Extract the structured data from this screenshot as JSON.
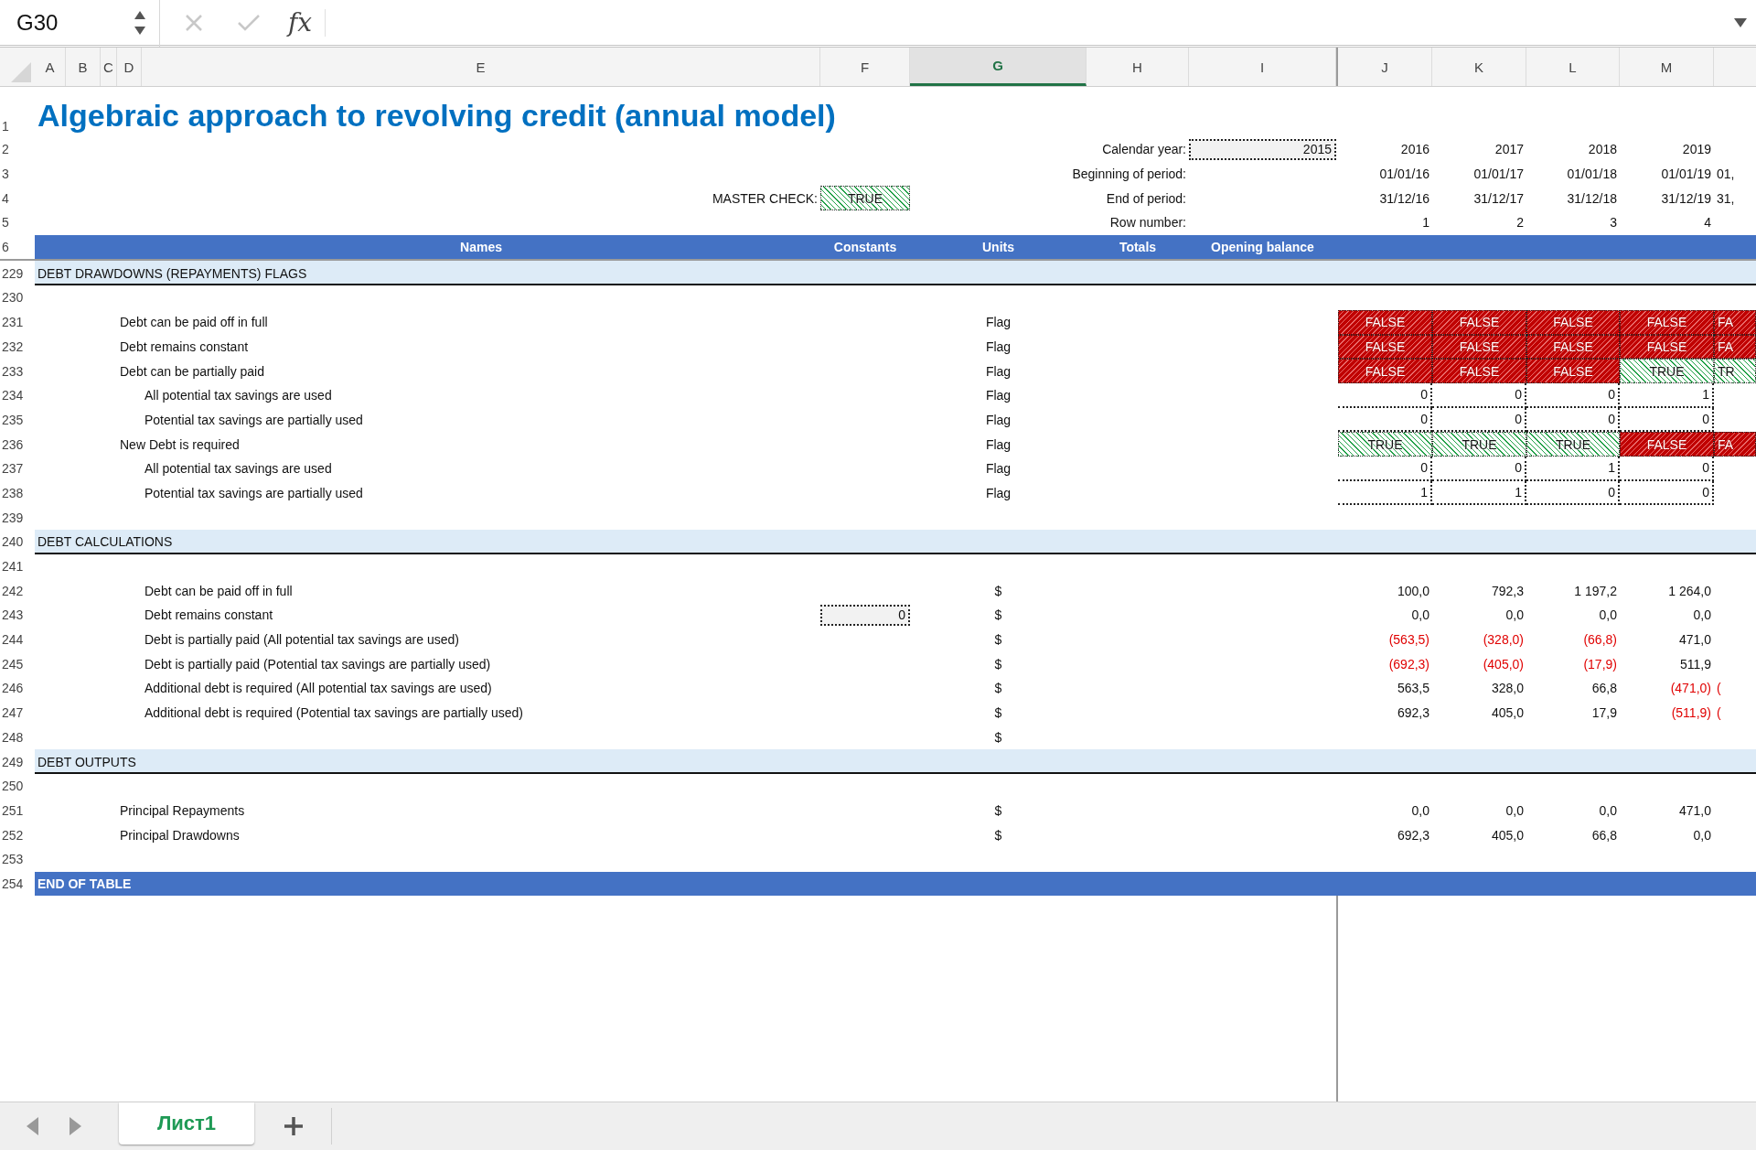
{
  "formula_bar": {
    "name_box": "G30",
    "function_label": "fx"
  },
  "column_headers": [
    {
      "label": "A",
      "selected": false
    },
    {
      "label": "B",
      "selected": false
    },
    {
      "label": "C",
      "selected": false
    },
    {
      "label": "D",
      "selected": false
    },
    {
      "label": "E",
      "selected": false
    },
    {
      "label": "F",
      "selected": false
    },
    {
      "label": "G",
      "selected": true
    },
    {
      "label": "H",
      "selected": false
    },
    {
      "label": "I",
      "selected": false
    },
    {
      "label": "J",
      "selected": false
    },
    {
      "label": "K",
      "selected": false
    },
    {
      "label": "L",
      "selected": false
    },
    {
      "label": "M",
      "selected": false
    }
  ],
  "rows": [
    {
      "number": "1",
      "kind": "title",
      "cells": {
        "A": {
          "kind": "title",
          "text": "Algebraic approach to revolving credit (annual model)"
        }
      }
    },
    {
      "number": "2",
      "kind": "plain",
      "cells": {
        "H": {
          "kind": "caption",
          "text": "Calendar year:"
        },
        "I": {
          "kind": "input",
          "text": "2015"
        },
        "J": {
          "kind": "number",
          "text": "2016"
        },
        "K": {
          "kind": "number",
          "text": "2017"
        },
        "L": {
          "kind": "number",
          "text": "2018"
        },
        "M": {
          "kind": "number",
          "text": "2019"
        }
      }
    },
    {
      "number": "3",
      "kind": "plain",
      "cells": {
        "H": {
          "kind": "caption",
          "text": "Beginning of period:"
        },
        "J": {
          "kind": "number",
          "text": "01/01/16"
        },
        "K": {
          "kind": "number",
          "text": "01/01/17"
        },
        "L": {
          "kind": "number",
          "text": "01/01/18"
        },
        "M": {
          "kind": "number",
          "text": "01/01/19"
        },
        "N": {
          "kind": "number",
          "text": "01,"
        }
      }
    },
    {
      "number": "4",
      "kind": "plain",
      "cells": {
        "E": {
          "kind": "caption",
          "text": "MASTER CHECK:"
        },
        "F": {
          "kind": "flag",
          "text": "TRUE",
          "passed": true
        },
        "H": {
          "kind": "caption",
          "text": "End of period:"
        },
        "J": {
          "kind": "number",
          "text": "31/12/16"
        },
        "K": {
          "kind": "number",
          "text": "31/12/17"
        },
        "L": {
          "kind": "number",
          "text": "31/12/18"
        },
        "M": {
          "kind": "number",
          "text": "31/12/19"
        },
        "N": {
          "kind": "number",
          "text": "31,"
        }
      }
    },
    {
      "number": "5",
      "kind": "plain",
      "cells": {
        "H": {
          "kind": "caption",
          "text": "Row number:"
        },
        "J": {
          "kind": "number",
          "text": "1"
        },
        "K": {
          "kind": "number",
          "text": "2"
        },
        "L": {
          "kind": "number",
          "text": "3"
        },
        "M": {
          "kind": "number",
          "text": "4"
        }
      }
    },
    {
      "number": "6",
      "kind": "header",
      "cells": {
        "E": {
          "kind": "header",
          "text": "Names"
        },
        "F": {
          "kind": "header",
          "text": "Constants"
        },
        "G": {
          "kind": "header",
          "text": "Units"
        },
        "H": {
          "kind": "header",
          "text": "Totals"
        },
        "I": {
          "kind": "header",
          "text": "Opening balance"
        }
      }
    },
    {
      "number": "229",
      "kind": "section",
      "cells": {
        "A": {
          "kind": "label",
          "text": "DEBT DRAWDOWNS (REPAYMENTS) FLAGS"
        }
      }
    },
    {
      "number": "230",
      "kind": "plain",
      "cells": {}
    },
    {
      "number": "231",
      "kind": "plain",
      "cells": {
        "D": {
          "kind": "label",
          "text": "Debt can be paid off in full"
        },
        "G": {
          "kind": "unit",
          "text": "Flag"
        },
        "J": {
          "kind": "flag",
          "text": "FALSE",
          "passed": false
        },
        "K": {
          "kind": "flag",
          "text": "FALSE",
          "passed": false
        },
        "L": {
          "kind": "flag",
          "text": "FALSE",
          "passed": false
        },
        "M": {
          "kind": "flag",
          "text": "FALSE",
          "passed": false
        },
        "N": {
          "kind": "flag",
          "text": "FA",
          "passed": false
        }
      }
    },
    {
      "number": "232",
      "kind": "plain",
      "cells": {
        "D": {
          "kind": "label",
          "text": "Debt remains constant"
        },
        "G": {
          "kind": "unit",
          "text": "Flag"
        },
        "J": {
          "kind": "flag",
          "text": "FALSE",
          "passed": false
        },
        "K": {
          "kind": "flag",
          "text": "FALSE",
          "passed": false
        },
        "L": {
          "kind": "flag",
          "text": "FALSE",
          "passed": false
        },
        "M": {
          "kind": "flag",
          "text": "FALSE",
          "passed": false
        },
        "N": {
          "kind": "flag",
          "text": "FA",
          "passed": false
        }
      }
    },
    {
      "number": "233",
      "kind": "plain",
      "cells": {
        "D": {
          "kind": "label",
          "text": "Debt can be partially paid"
        },
        "G": {
          "kind": "unit",
          "text": "Flag"
        },
        "J": {
          "kind": "flag",
          "text": "FALSE",
          "passed": false
        },
        "K": {
          "kind": "flag",
          "text": "FALSE",
          "passed": false
        },
        "L": {
          "kind": "flag",
          "text": "FALSE",
          "passed": false
        },
        "M": {
          "kind": "flag",
          "text": "TRUE",
          "passed": true
        },
        "N": {
          "kind": "flag",
          "text": "TR",
          "passed": true
        }
      }
    },
    {
      "number": "234",
      "kind": "plain",
      "cells": {
        "E": {
          "kind": "label",
          "text": "All potential tax savings are used"
        },
        "G": {
          "kind": "unit",
          "text": "Flag"
        },
        "J": {
          "kind": "count",
          "text": "0"
        },
        "K": {
          "kind": "count",
          "text": "0"
        },
        "L": {
          "kind": "count",
          "text": "0"
        },
        "M": {
          "kind": "count",
          "text": "1"
        }
      }
    },
    {
      "number": "235",
      "kind": "plain",
      "cells": {
        "E": {
          "kind": "label",
          "text": "Potential tax savings are partially used"
        },
        "G": {
          "kind": "unit",
          "text": "Flag"
        },
        "J": {
          "kind": "count",
          "text": "0"
        },
        "K": {
          "kind": "count",
          "text": "0"
        },
        "L": {
          "kind": "count",
          "text": "0"
        },
        "M": {
          "kind": "count",
          "text": "0"
        }
      }
    },
    {
      "number": "236",
      "kind": "plain",
      "cells": {
        "D": {
          "kind": "label",
          "text": "New Debt is required"
        },
        "G": {
          "kind": "unit",
          "text": "Flag"
        },
        "J": {
          "kind": "flag",
          "text": "TRUE",
          "passed": true
        },
        "K": {
          "kind": "flag",
          "text": "TRUE",
          "passed": true
        },
        "L": {
          "kind": "flag",
          "text": "TRUE",
          "passed": true
        },
        "M": {
          "kind": "flag",
          "text": "FALSE",
          "passed": false
        },
        "N": {
          "kind": "flag",
          "text": "FA",
          "passed": false
        }
      }
    },
    {
      "number": "237",
      "kind": "plain",
      "cells": {
        "E": {
          "kind": "label",
          "text": "All potential tax savings are used"
        },
        "G": {
          "kind": "unit",
          "text": "Flag"
        },
        "J": {
          "kind": "count",
          "text": "0"
        },
        "K": {
          "kind": "count",
          "text": "0"
        },
        "L": {
          "kind": "count",
          "text": "1"
        },
        "M": {
          "kind": "count",
          "text": "0"
        }
      }
    },
    {
      "number": "238",
      "kind": "plain",
      "cells": {
        "E": {
          "kind": "label",
          "text": "Potential tax savings are partially used"
        },
        "G": {
          "kind": "unit",
          "text": "Flag"
        },
        "J": {
          "kind": "count",
          "text": "1"
        },
        "K": {
          "kind": "count",
          "text": "1"
        },
        "L": {
          "kind": "count",
          "text": "0"
        },
        "M": {
          "kind": "count",
          "text": "0"
        }
      }
    },
    {
      "number": "239",
      "kind": "plain",
      "cells": {}
    },
    {
      "number": "240",
      "kind": "section",
      "cells": {
        "A": {
          "kind": "label",
          "text": "DEBT CALCULATIONS"
        }
      }
    },
    {
      "number": "241",
      "kind": "plain",
      "cells": {}
    },
    {
      "number": "242",
      "kind": "plain",
      "cells": {
        "E": {
          "kind": "label",
          "text": "Debt can be paid off in full"
        },
        "G": {
          "kind": "unit",
          "text": "$"
        },
        "J": {
          "kind": "number",
          "text": "100,0",
          "negative": false
        },
        "K": {
          "kind": "number",
          "text": "792,3",
          "negative": false
        },
        "L": {
          "kind": "number",
          "text": "1 197,2",
          "negative": false
        },
        "M": {
          "kind": "number",
          "text": "1 264,0",
          "negative": false
        }
      }
    },
    {
      "number": "243",
      "kind": "plain",
      "cells": {
        "E": {
          "kind": "label",
          "text": "Debt remains constant"
        },
        "F": {
          "kind": "input",
          "text": "0"
        },
        "G": {
          "kind": "unit",
          "text": "$"
        },
        "J": {
          "kind": "number",
          "text": "0,0",
          "negative": false
        },
        "K": {
          "kind": "number",
          "text": "0,0",
          "negative": false
        },
        "L": {
          "kind": "number",
          "text": "0,0",
          "negative": false
        },
        "M": {
          "kind": "number",
          "text": "0,0",
          "negative": false
        }
      }
    },
    {
      "number": "244",
      "kind": "plain",
      "cells": {
        "E": {
          "kind": "label",
          "text": "Debt is partially paid (All potential tax savings are used)"
        },
        "G": {
          "kind": "unit",
          "text": "$"
        },
        "J": {
          "kind": "number",
          "text": "(563,5)",
          "negative": true
        },
        "K": {
          "kind": "number",
          "text": "(328,0)",
          "negative": true
        },
        "L": {
          "kind": "number",
          "text": "(66,8)",
          "negative": true
        },
        "M": {
          "kind": "number",
          "text": "471,0",
          "negative": false
        }
      }
    },
    {
      "number": "245",
      "kind": "plain",
      "cells": {
        "E": {
          "kind": "label",
          "text": "Debt is partially paid (Potential tax savings are partially used)"
        },
        "G": {
          "kind": "unit",
          "text": "$"
        },
        "J": {
          "kind": "number",
          "text": "(692,3)",
          "negative": true
        },
        "K": {
          "kind": "number",
          "text": "(405,0)",
          "negative": true
        },
        "L": {
          "kind": "number",
          "text": "(17,9)",
          "negative": true
        },
        "M": {
          "kind": "number",
          "text": "511,9",
          "negative": false
        }
      }
    },
    {
      "number": "246",
      "kind": "plain",
      "cells": {
        "E": {
          "kind": "label",
          "text": "Additional debt is required (All potential tax savings are used)"
        },
        "G": {
          "kind": "unit",
          "text": "$"
        },
        "J": {
          "kind": "number",
          "text": "563,5",
          "negative": false
        },
        "K": {
          "kind": "number",
          "text": "328,0",
          "negative": false
        },
        "L": {
          "kind": "number",
          "text": "66,8",
          "negative": false
        },
        "M": {
          "kind": "number",
          "text": "(471,0)",
          "negative": true
        },
        "N": {
          "kind": "number",
          "text": "(",
          "negative": true
        }
      }
    },
    {
      "number": "247",
      "kind": "plain",
      "cells": {
        "E": {
          "kind": "label",
          "text": "Additional debt is required (Potential tax savings are partially used)"
        },
        "G": {
          "kind": "unit",
          "text": "$"
        },
        "J": {
          "kind": "number",
          "text": "692,3",
          "negative": false
        },
        "K": {
          "kind": "number",
          "text": "405,0",
          "negative": false
        },
        "L": {
          "kind": "number",
          "text": "17,9",
          "negative": false
        },
        "M": {
          "kind": "number",
          "text": "(511,9)",
          "negative": true
        },
        "N": {
          "kind": "number",
          "text": "(",
          "negative": true
        }
      }
    },
    {
      "number": "248",
      "kind": "plain",
      "cells": {
        "G": {
          "kind": "unit",
          "text": "$"
        }
      }
    },
    {
      "number": "249",
      "kind": "section",
      "cells": {
        "A": {
          "kind": "label",
          "text": "DEBT OUTPUTS"
        }
      }
    },
    {
      "number": "250",
      "kind": "plain",
      "cells": {}
    },
    {
      "number": "251",
      "kind": "plain",
      "cells": {
        "D": {
          "kind": "label",
          "text": "Principal Repayments"
        },
        "G": {
          "kind": "unit",
          "text": "$"
        },
        "J": {
          "kind": "number",
          "text": "0,0",
          "negative": false
        },
        "K": {
          "kind": "number",
          "text": "0,0",
          "negative": false
        },
        "L": {
          "kind": "number",
          "text": "0,0",
          "negative": false
        },
        "M": {
          "kind": "number",
          "text": "471,0",
          "negative": false
        }
      }
    },
    {
      "number": "252",
      "kind": "plain",
      "cells": {
        "D": {
          "kind": "label",
          "text": "Principal Drawdowns"
        },
        "G": {
          "kind": "unit",
          "text": "$"
        },
        "J": {
          "kind": "number",
          "text": "692,3",
          "negative": false
        },
        "K": {
          "kind": "number",
          "text": "405,0",
          "negative": false
        },
        "L": {
          "kind": "number",
          "text": "66,8",
          "negative": false
        },
        "M": {
          "kind": "number",
          "text": "0,0",
          "negative": false
        }
      }
    },
    {
      "number": "253",
      "kind": "plain",
      "cells": {}
    },
    {
      "number": "254",
      "kind": "end",
      "cells": {
        "A": {
          "kind": "label",
          "text": "END OF TABLE"
        }
      }
    }
  ],
  "sheet_tabs": [
    {
      "label": "Лист1",
      "selected": true
    }
  ]
}
